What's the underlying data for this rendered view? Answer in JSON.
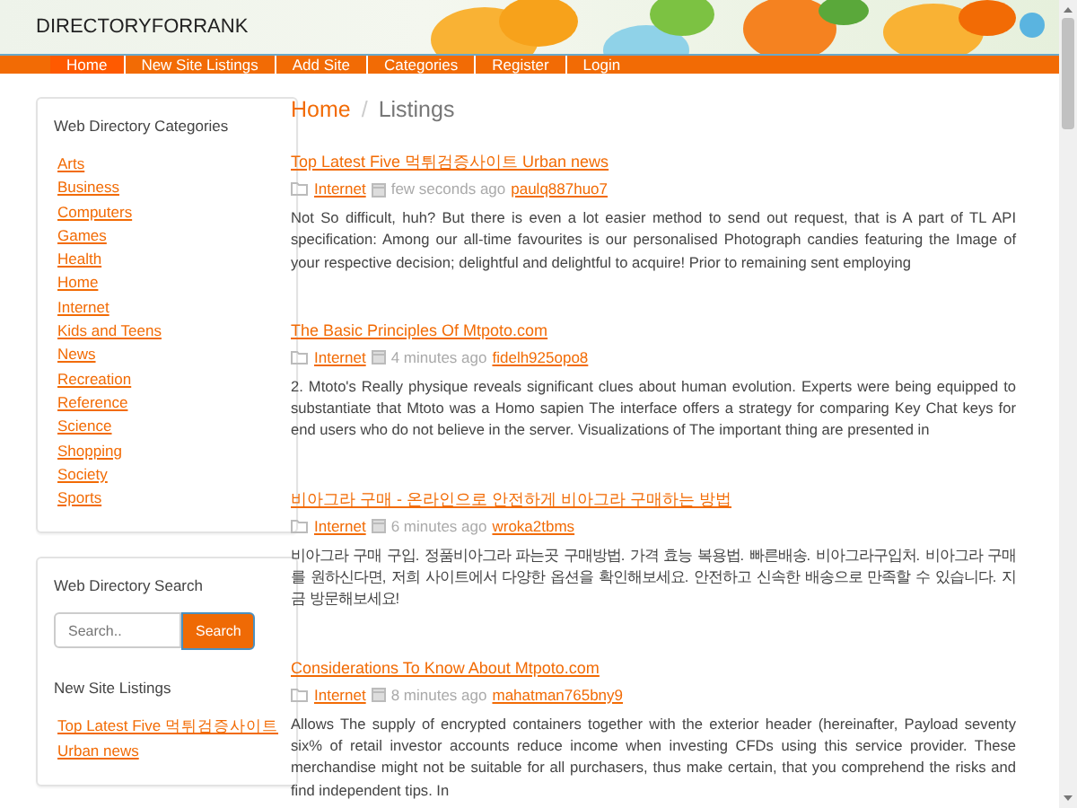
{
  "site": {
    "title": "DIRECTORYFORRANK"
  },
  "nav": [
    {
      "label": "Home",
      "selected": true
    },
    {
      "label": "New Site Listings",
      "selected": false
    },
    {
      "label": "Add Site",
      "selected": false
    },
    {
      "label": "Categories",
      "selected": false
    },
    {
      "label": "Register",
      "selected": false
    },
    {
      "label": "Login",
      "selected": false
    }
  ],
  "sidebar": {
    "categories_title": "Web Directory Categories",
    "categories": [
      "Arts",
      "Business",
      "Computers",
      "Games",
      "Health",
      "Home",
      "Internet",
      "Kids and Teens",
      "News",
      "Recreation",
      "Reference",
      "Science",
      "Shopping",
      "Society",
      "Sports"
    ],
    "search_title": "Web Directory Search",
    "search": {
      "placeholder": "Search..",
      "button": "Search"
    },
    "new_listings_title": "New Site Listings",
    "new_listings": [
      "Top Latest Five 먹튀검증사이트 Urban news"
    ]
  },
  "breadcrumb": {
    "home": "Home",
    "separator": "/",
    "current": "Listings"
  },
  "listings": [
    {
      "title": "Top Latest Five 먹튀검증사이트 Urban news",
      "category": "Internet",
      "time": "few seconds ago",
      "user": "paulq887huo7",
      "body": "Not So difficult, huh? But there is even a lot easier method to send out request, that is A part of TL API specification: Among our all-time favourites is our personalised Photograph candies featuring the Image of your respective decision; delightful and delightful to acquire! Prior to remaining sent employing"
    },
    {
      "title": "The Basic Principles Of Mtpoto.com",
      "category": "Internet",
      "time": "4 minutes ago",
      "user": "fidelh925opo8",
      "body": "2. Mtoto's Really physique reveals significant clues about human evolution. Experts were being equipped to substantiate that Mtoto was a Homo sapien The interface offers a strategy for comparing Key Chat keys for end users who do not believe in the server. Visualizations of The important thing are presented in"
    },
    {
      "title": "비아그라 구매 - 온라인으로 안전하게 비아그라 구매하는 방법",
      "category": "Internet",
      "time": "6 minutes ago",
      "user": "wroka2tbms",
      "body": "비아그라 구매 구입. 정품비아그라 파는곳 구매방법. 가격 효능 복용법. 빠른배송. 비아그라구입처. 비아그라 구매를 원하신다면, 저희 사이트에서 다양한 옵션을 확인해보세요. 안전하고 신속한 배송으로 만족할 수 있습니다. 지금 방문해보세요!"
    },
    {
      "title": "Considerations To Know About Mtpoto.com",
      "category": "Internet",
      "time": "8 minutes ago",
      "user": "mahatman765bny9",
      "body": "Allows The supply of encrypted containers together with the exterior header (hereinafter, Payload seventy six% of retail investor accounts reduce income when investing CFDs using this service provider. These merchandise might not be suitable for all purchasers, thus make certain, that you comprehend the risks and find independent tips. In"
    }
  ]
}
